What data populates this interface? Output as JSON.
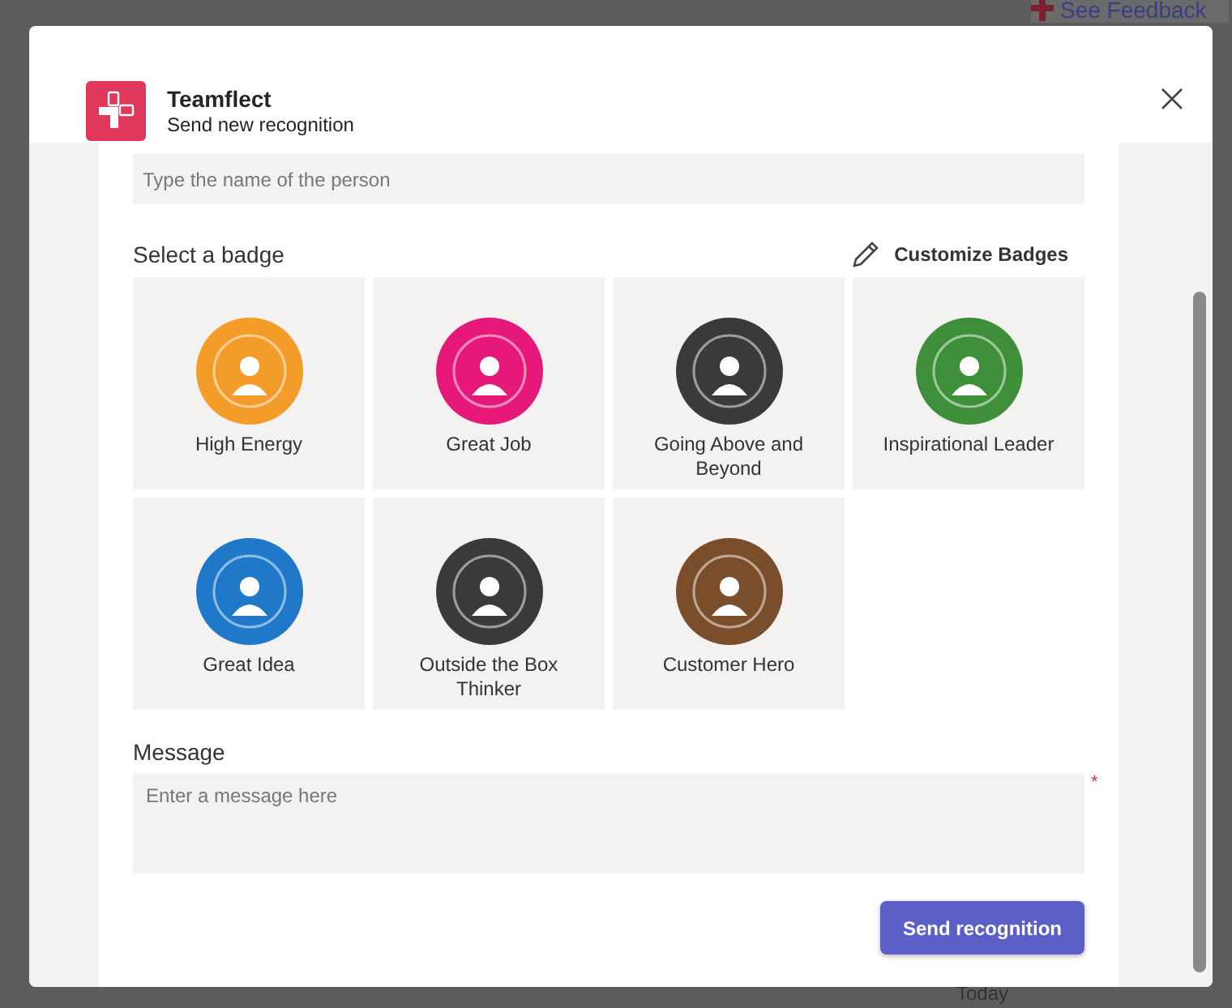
{
  "background": {
    "feedback_link": "See Feedback",
    "date_label": "Today"
  },
  "dialog": {
    "app_name": "Teamflect",
    "subtitle": "Send new recognition"
  },
  "person_field": {
    "placeholder": "Type the name of the person"
  },
  "badge_section": {
    "title": "Select a badge",
    "customize": "Customize Badges"
  },
  "badges": [
    {
      "label": "High Energy",
      "color": "#f39c2a",
      "selected": false
    },
    {
      "label": "Great Job",
      "color": "#e6197a",
      "selected": false
    },
    {
      "label": "Going Above and Beyond",
      "color": "#3a3a3a",
      "selected": false
    },
    {
      "label": "Inspirational Leader",
      "color": "#3f8f3a",
      "selected": false
    },
    {
      "label": "Great Idea",
      "color": "#1f78c8",
      "selected": false
    },
    {
      "label": "Outside the Box Thinker",
      "color": "#3a3a3a",
      "selected": false
    },
    {
      "label": "Customer Hero",
      "color": "#7a4e2a",
      "selected": false
    }
  ],
  "message": {
    "label": "Message",
    "placeholder": "Enter a message here",
    "required_mark": "*"
  },
  "submit": "Send recognition"
}
